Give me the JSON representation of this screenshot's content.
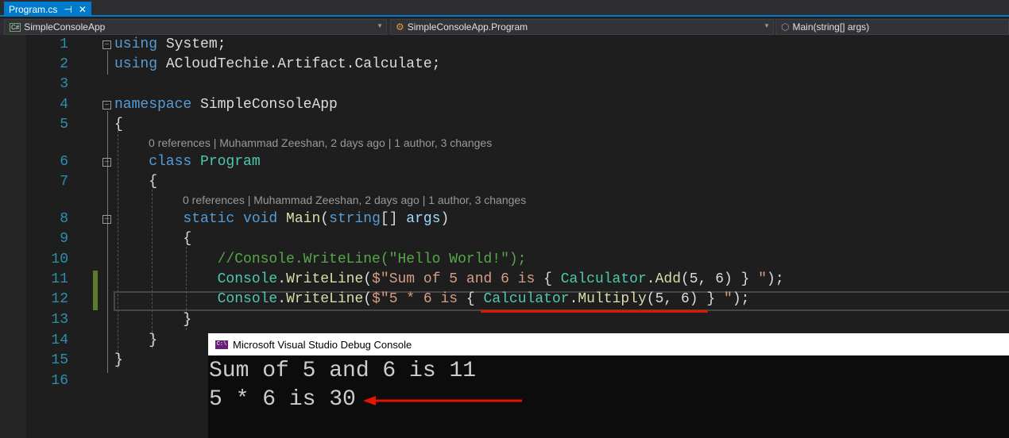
{
  "tab": {
    "title": "Program.cs",
    "pin": "⊣",
    "close": "✕"
  },
  "nav": {
    "project": "SimpleConsoleApp",
    "class": "SimpleConsoleApp.Program",
    "member": "Main(string[] args)"
  },
  "colors": {
    "accent": "#007acc",
    "annotation": "#e51400"
  },
  "code": [
    {
      "n": "1",
      "tokens": [
        {
          "t": "using",
          "c": "kw"
        },
        {
          "t": " System;",
          "c": ""
        }
      ]
    },
    {
      "n": "2",
      "tokens": [
        {
          "t": "using",
          "c": "kw"
        },
        {
          "t": " ACloudTechie.Artifact.Calculate;",
          "c": ""
        }
      ]
    },
    {
      "n": "3",
      "tokens": []
    },
    {
      "n": "4",
      "tokens": [
        {
          "t": "namespace",
          "c": "kw"
        },
        {
          "t": " SimpleConsoleApp",
          "c": ""
        }
      ]
    },
    {
      "n": "5",
      "tokens": [
        {
          "t": "{",
          "c": ""
        }
      ]
    },
    {
      "n": "6",
      "tokens": [
        {
          "t": "    class",
          "c": "kw"
        },
        {
          "t": " ",
          "c": ""
        },
        {
          "t": "Program",
          "c": "ty"
        }
      ]
    },
    {
      "n": "7",
      "tokens": [
        {
          "t": "    {",
          "c": ""
        }
      ]
    },
    {
      "n": "8",
      "tokens": [
        {
          "t": "        static void",
          "c": "kw"
        },
        {
          "t": " ",
          "c": ""
        },
        {
          "t": "Main",
          "c": "mt"
        },
        {
          "t": "(",
          "c": ""
        },
        {
          "t": "string",
          "c": "kw"
        },
        {
          "t": "[] ",
          "c": ""
        },
        {
          "t": "args",
          "c": "pm"
        },
        {
          "t": ")",
          "c": ""
        }
      ]
    },
    {
      "n": "9",
      "tokens": [
        {
          "t": "        {",
          "c": ""
        }
      ]
    },
    {
      "n": "10",
      "tokens": [
        {
          "t": "            //Console.WriteLine(\"Hello World!\");",
          "c": "cm"
        }
      ]
    },
    {
      "n": "11",
      "tokens": [
        {
          "t": "            ",
          "c": ""
        },
        {
          "t": "Console",
          "c": "ty"
        },
        {
          "t": ".",
          "c": ""
        },
        {
          "t": "WriteLine",
          "c": "mt"
        },
        {
          "t": "(",
          "c": ""
        },
        {
          "t": "$\"Sum of 5 and 6 is ",
          "c": "st"
        },
        {
          "t": "{ ",
          "c": ""
        },
        {
          "t": "Calculator",
          "c": "ty"
        },
        {
          "t": ".",
          "c": ""
        },
        {
          "t": "Add",
          "c": "mt"
        },
        {
          "t": "(5, 6) }",
          "c": ""
        },
        {
          "t": " \"",
          "c": "st"
        },
        {
          "t": ");",
          "c": ""
        }
      ]
    },
    {
      "n": "12",
      "tokens": [
        {
          "t": "            ",
          "c": ""
        },
        {
          "t": "Console",
          "c": "ty"
        },
        {
          "t": ".",
          "c": ""
        },
        {
          "t": "WriteLine",
          "c": "mt"
        },
        {
          "t": "(",
          "c": ""
        },
        {
          "t": "$\"5 * 6 is ",
          "c": "st"
        },
        {
          "t": "{ ",
          "c": ""
        },
        {
          "t": "Calculator",
          "c": "ty"
        },
        {
          "t": ".",
          "c": ""
        },
        {
          "t": "Multiply",
          "c": "mt"
        },
        {
          "t": "(5, 6) }",
          "c": ""
        },
        {
          "t": " \"",
          "c": "st"
        },
        {
          "t": ");",
          "c": ""
        }
      ]
    },
    {
      "n": "13",
      "tokens": [
        {
          "t": "        }",
          "c": ""
        }
      ]
    },
    {
      "n": "14",
      "tokens": [
        {
          "t": "    }",
          "c": ""
        }
      ]
    },
    {
      "n": "15",
      "tokens": [
        {
          "t": "}",
          "c": ""
        }
      ]
    },
    {
      "n": "16",
      "tokens": []
    }
  ],
  "codelens": [
    "0 references | Muhammad Zeeshan, 2 days ago | 1 author, 3 changes",
    "0 references | Muhammad Zeeshan, 2 days ago | 1 author, 3 changes"
  ],
  "console": {
    "title": "Microsoft Visual Studio Debug Console",
    "icon": "C:\\",
    "lines": [
      "Sum of 5 and 6 is 11",
      "5 * 6 is 30"
    ]
  }
}
